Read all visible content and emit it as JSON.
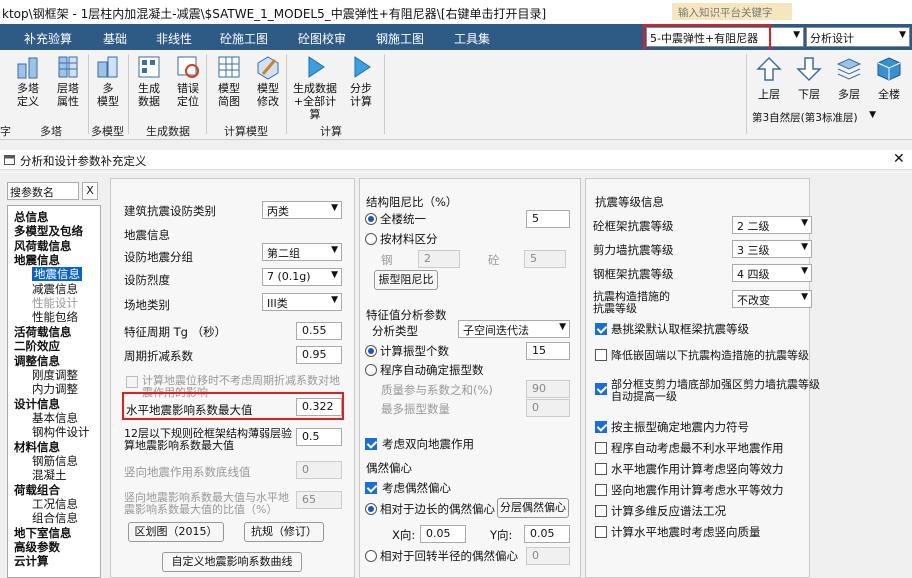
{
  "window": {
    "title": "ktop\\钢框架 - 1层柱内加混凝土-减震\\$SATWE_1_MODEL5_中震弹性+有阻尼器\\[右键单击打开目录]",
    "search_placeholder": "输入知识平台关键字"
  },
  "menu": [
    "补充验算",
    "基础",
    "非线性",
    "砼施工图",
    "砼图校审",
    "钢施工图",
    "工具集"
  ],
  "mode_select": "5-中震弹性+有阻尼器",
  "design_select": "分析设计",
  "ribbon": {
    "buttons": [
      {
        "l1": "多塔",
        "l2": "定义",
        "icon": "tower-define-icon"
      },
      {
        "l1": "层塔",
        "l2": "属性",
        "icon": "tower-property-icon"
      },
      {
        "l1": "多",
        "l2": "模型",
        "icon": "multi-model-icon"
      },
      {
        "l1": "生成",
        "l2": "数据",
        "icon": "generate-data-icon"
      },
      {
        "l1": "错误",
        "l2": "定位",
        "icon": "error-locate-icon"
      },
      {
        "l1": "模型",
        "l2": "简图",
        "icon": "model-sketch-icon"
      },
      {
        "l1": "模型",
        "l2": "修改",
        "icon": "model-modify-icon"
      },
      {
        "l1": "生成数据",
        "l2": "+全部计算",
        "icon": "play-all-icon"
      },
      {
        "l1": "分步",
        "l2": "计算",
        "icon": "step-calc-icon"
      }
    ],
    "groups": [
      "多塔",
      "多模型",
      "生成数据",
      "计算模型",
      "计算"
    ],
    "nav": [
      {
        "label": "上层",
        "icon": "arrow-up-icon"
      },
      {
        "label": "下层",
        "icon": "arrow-down-icon"
      },
      {
        "label": "多层",
        "icon": "layers-icon"
      },
      {
        "label": "全楼",
        "icon": "cube-icon"
      }
    ],
    "floor_select": "第3自然层(第3标准层)",
    "left_cut": "字"
  },
  "dialog": {
    "title": "分析和设计参数补充定义",
    "search_value": "搜参数名",
    "search_clear": "X",
    "tree": [
      {
        "t": "总信息",
        "lvl": 0
      },
      {
        "t": "多模型及包络",
        "lvl": 0
      },
      {
        "t": "风荷载信息",
        "lvl": 0
      },
      {
        "t": "地震信息",
        "lvl": 0
      },
      {
        "t": "地震信息",
        "lvl": 1,
        "sel": true
      },
      {
        "t": "减震信息",
        "lvl": 1
      },
      {
        "t": "性能设计",
        "lvl": 1,
        "dis": true
      },
      {
        "t": "性能包络",
        "lvl": 1
      },
      {
        "t": "活荷载信息",
        "lvl": 0
      },
      {
        "t": "二阶效应",
        "lvl": 0
      },
      {
        "t": "调整信息",
        "lvl": 0
      },
      {
        "t": "刚度调整",
        "lvl": 1
      },
      {
        "t": "内力调整",
        "lvl": 1
      },
      {
        "t": "设计信息",
        "lvl": 0
      },
      {
        "t": "基本信息",
        "lvl": 1
      },
      {
        "t": "钢构件设计",
        "lvl": 1
      },
      {
        "t": "材料信息",
        "lvl": 0
      },
      {
        "t": "钢筋信息",
        "lvl": 1
      },
      {
        "t": "混凝土",
        "lvl": 1
      },
      {
        "t": "荷载组合",
        "lvl": 0
      },
      {
        "t": "工况信息",
        "lvl": 1
      },
      {
        "t": "组合信息",
        "lvl": 1
      },
      {
        "t": "地下室信息",
        "lvl": 0
      },
      {
        "t": "高级参数",
        "lvl": 0
      },
      {
        "t": "云计算",
        "lvl": 0
      }
    ],
    "left": {
      "category_label": "建筑抗震设防类别",
      "category_value": "丙类",
      "seismic_section": "地震信息",
      "group_label": "设防地震分组",
      "group_value": "第二组",
      "intensity_label": "设防烈度",
      "intensity_value": "7 (0.1g)",
      "site_label": "场地类别",
      "site_value": "III类",
      "tg_label": "特征周期 Tg （秒）",
      "tg_value": "0.55",
      "period_label": "周期折减系数",
      "period_value": "0.95",
      "ignore_label_1": "计算地震位移时不考虑周期折减系数对地",
      "ignore_label_2": "震作用的影响",
      "kmax_label": "水平地震影响系数最大值",
      "kmax_value": "0.322",
      "weak_label_1": "12层以下规则砼框架结构薄弱层验",
      "weak_label_2": "算地震影响系数最大值",
      "weak_value": "0.5",
      "vmin_label": "竖向地震作用系数底线值",
      "vmin_value": "0",
      "vratio_label_1": "竖向地震影响系数最大值与水平地",
      "vratio_label_2": "震影响系数最大值的比值（%）",
      "vratio_value": "65",
      "zone_button": "区划图（2015）",
      "resilience_button": "抗规（修订）",
      "curve_button": "自定义地震影响系数曲线"
    },
    "middle": {
      "damping_title": "结构阻尼比（%）",
      "unified_label": "全楼统一",
      "unified_value": "5",
      "by_material_label": "按材料区分",
      "steel_label": "钢",
      "steel_value": "2",
      "concrete_label": "砼",
      "concrete_value": "5",
      "mode_damping_button": "振型阻尼比",
      "eigen_title": "特征值分析参数",
      "analysis_type_label": "分析类型",
      "analysis_type_value": "子空间迭代法",
      "mode_count_label": "计算振型个数",
      "mode_count_value": "15",
      "auto_mode_label": "程序自动确定振型数",
      "mass_sum_label": "质量参与系数之和(%)",
      "mass_sum_value": "90",
      "min_mode_label": "最多振型数量",
      "min_mode_value": "0",
      "bidirectional_label": "考虑双向地震作用",
      "ecc_title": "偶然偏心",
      "ecc_label": "考虑偶然偏心",
      "ecc_rel_label": "相对于边长的偶然偏心",
      "layer_ecc_button": "分层偶然偏心",
      "x_label": "X向:",
      "x_value": "0.05",
      "y_label": "Y向:",
      "y_value": "0.05",
      "ecc_radius_label": "相对于回转半径的偶然偏心",
      "ecc_radius_value": "0"
    },
    "right": {
      "grade_title": "抗震等级信息",
      "frame_label": "砼框架抗震等级",
      "frame_value": "2  二级",
      "wall_label": "剪力墙抗震等级",
      "wall_value": "3  三级",
      "steel_label": "钢框架抗震等级",
      "steel_value": "4  四级",
      "measure_label_1": "抗震构造措施的",
      "measure_label_2": "抗震等级",
      "measure_value": "不改变",
      "cb1": "悬挑梁默认取框梁抗震等级",
      "cb2": "降低嵌固端以下抗震构造措施的抗震等级",
      "cb3_1": "部分框支剪力墙底部加强区剪力墙抗震等级",
      "cb3_2": "自动提高一级",
      "cb4": "按主振型确定地震内力符号",
      "cb5": "程序自动考虑最不利水平地震作用",
      "cb6": "水平地震作用计算考虑竖向等效力",
      "cb7": "竖向地震作用计算考虑水平等效力",
      "cb8": "计算多维反应谱法工况",
      "cb9": "计算水平地震时考虑竖向质量"
    }
  }
}
